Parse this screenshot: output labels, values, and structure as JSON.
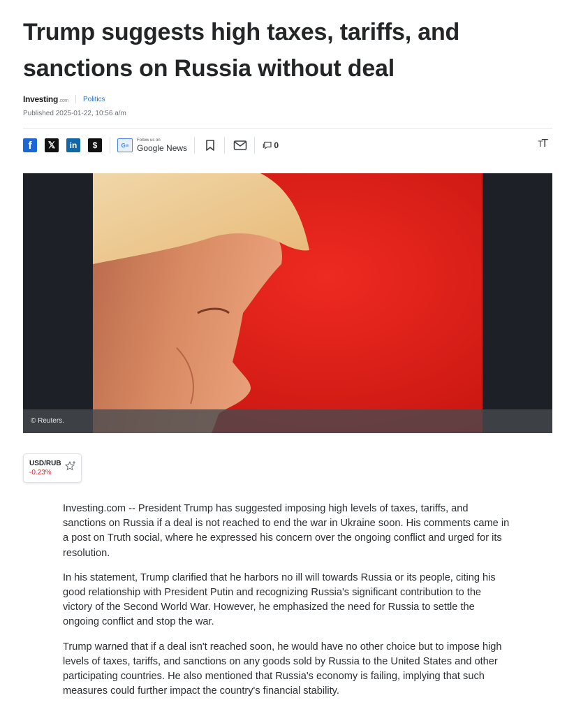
{
  "article": {
    "title": "Trump suggests high taxes, tariffs, and sanctions on Russia without deal",
    "source_logo": "Investing",
    "source_logo_suffix": ".com",
    "category": "Politics",
    "published": "Published 2025-01-22, 10:56 a/m",
    "paragraphs": [
      "Investing.com -- President Trump has suggested imposing high levels of taxes, tariffs, and sanctions on Russia if a deal is not reached to end the war in Ukraine soon. His comments came in a post on Truth social, where he expressed his concern over the ongoing conflict and urged for its resolution.",
      "In his statement, Trump clarified that he harbors no ill will towards Russia or its people, citing his good relationship with President Putin and recognizing Russia's significant contribution to the victory of the Second World War. However, he emphasized the need for Russia to settle the ongoing conflict and stop the war.",
      "Trump warned that if a deal isn't reached soon, he would have no other choice but to impose high levels of taxes, tariffs, and sanctions on any goods sold by Russia to the United States and other participating countries. He also mentioned that Russia's economy is failing, implying that such measures could further impact the country's financial stability."
    ]
  },
  "share": {
    "facebook_glyph": "f",
    "x_glyph": "𝕏",
    "linkedin_glyph": "in",
    "blogger_glyph": "$",
    "google_news_small": "Follow us on",
    "google_news_label": "Google News",
    "google_news_icon_glyph": "G≡",
    "comment_count": "0",
    "text_size_glyph_big": "T",
    "text_size_glyph_small": "T"
  },
  "hero_image": {
    "caption": "© Reuters.",
    "background_color": "#1d2026",
    "accent_red": "#e3201b"
  },
  "ticker": {
    "symbol": "USD/RUB",
    "change": "-0.23%",
    "change_color": "#d6252e"
  }
}
